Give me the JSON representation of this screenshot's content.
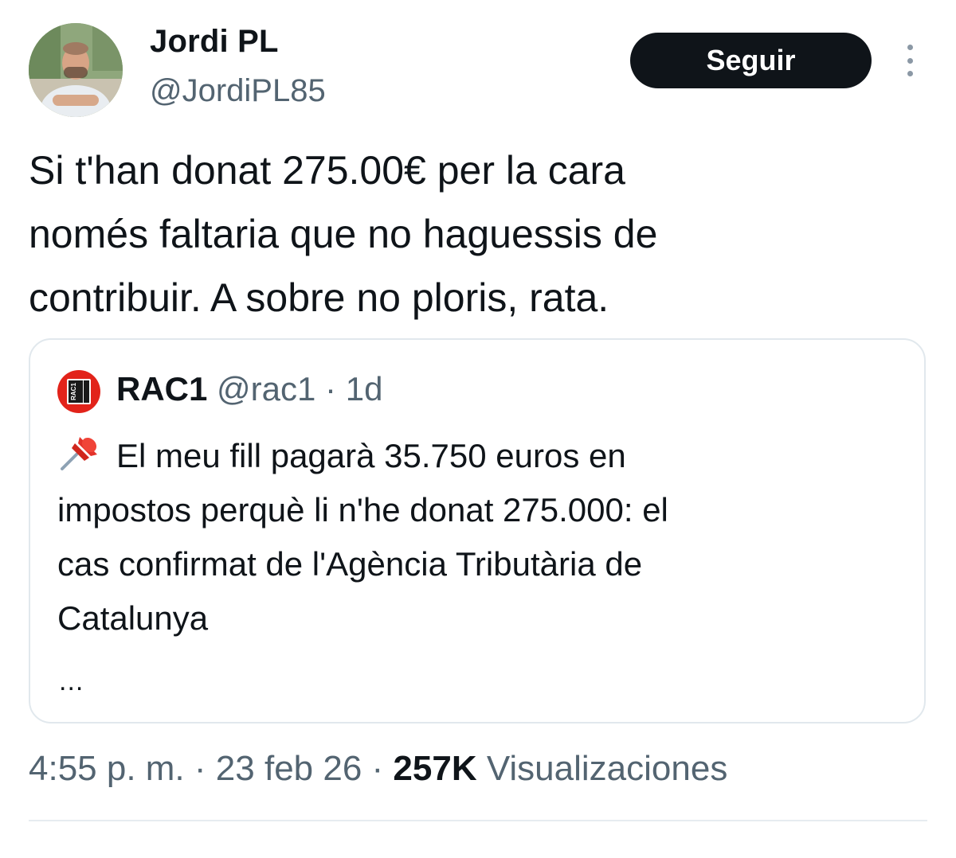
{
  "author": {
    "display_name": "Jordi PL",
    "handle": "@JordiPL85",
    "avatar_icon": "profile-photo"
  },
  "follow_button": {
    "label": "Seguir"
  },
  "more_icon": "more-vertical-icon",
  "tweet_text": {
    "lines": [
      "Si t'han donat 275.00€ per la cara",
      "només faltaria que no haguessis de",
      "contribuir. A sobre no ploris, rata."
    ]
  },
  "quote": {
    "avatar_text": "RAC1",
    "name": "RAC1",
    "handle": "@rac1",
    "separator": "·",
    "time": "1d",
    "pin_icon": "pushpin-icon",
    "lines": [
      "El meu fill pagarà 35.750 euros en",
      "impostos perquè li n'he donat 275.000: el",
      "cas confirmat de l'Agència Tributària de",
      "Catalunya"
    ],
    "ellipsis": "..."
  },
  "footer": {
    "time": "4:55 p. m.",
    "separator": "·",
    "date": "23 feb 26",
    "views_count": "257K",
    "views_label": "Visualizaciones"
  },
  "colors": {
    "text_primary": "#0f1419",
    "text_secondary": "#536471",
    "button_bg": "#0f1419",
    "rac1_red": "#e2231a",
    "border": "#e1e8ed"
  }
}
